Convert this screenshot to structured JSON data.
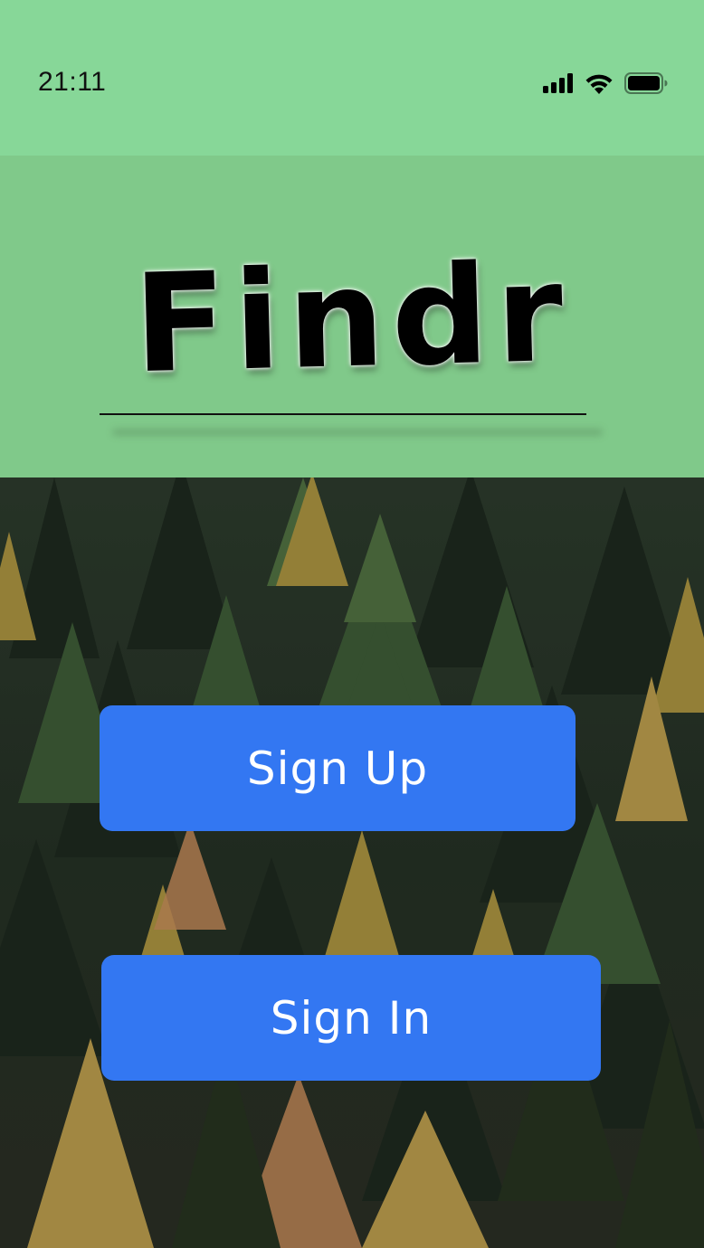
{
  "status_bar": {
    "time": "21:11",
    "icons": [
      "cellular-signal-icon",
      "wifi-icon",
      "battery-icon"
    ]
  },
  "header": {
    "app_title": "Findr"
  },
  "actions": {
    "sign_up_label": "Sign Up",
    "sign_in_label": "Sign In"
  },
  "colors": {
    "status_bar_bg": "#87d798",
    "header_bg": "#80c98a",
    "button_bg": "#3377f2",
    "button_text": "#ffffff"
  }
}
